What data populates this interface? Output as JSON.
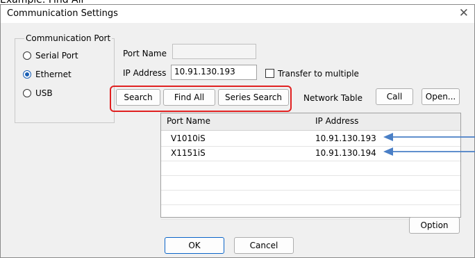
{
  "caption": "Example: Find All",
  "window": {
    "title": "Communication Settings",
    "close_glyph": "✕"
  },
  "comm_port": {
    "group_label": "Communication Port",
    "options": [
      {
        "label": "Serial Port",
        "checked": false
      },
      {
        "label": "Ethernet",
        "checked": true
      },
      {
        "label": "USB",
        "checked": false
      }
    ]
  },
  "port_name": {
    "label": "Port Name",
    "value": ""
  },
  "ip_address": {
    "label": "IP Address",
    "value": "10.91.130.193"
  },
  "transfer": {
    "label": "Transfer to multiple",
    "checked": false
  },
  "toolbar": {
    "search": "Search",
    "find_all": "Find All",
    "series_search": "Series Search",
    "network_table": "Network Table",
    "call": "Call",
    "open": "Open..."
  },
  "table": {
    "columns": [
      "Port Name",
      "IP Address"
    ],
    "rows": [
      [
        "V1010iS",
        "10.91.130.193"
      ],
      [
        "X1151iS",
        "10.91.130.194"
      ],
      [
        "",
        ""
      ],
      [
        "",
        ""
      ],
      [
        "",
        ""
      ],
      [
        "",
        ""
      ]
    ]
  },
  "buttons": {
    "option": "Option",
    "ok": "OK",
    "cancel": "Cancel"
  },
  "colors": {
    "accent": "#1a5fb4",
    "highlight": "#e02020",
    "arrow": "#4a7fc6"
  }
}
